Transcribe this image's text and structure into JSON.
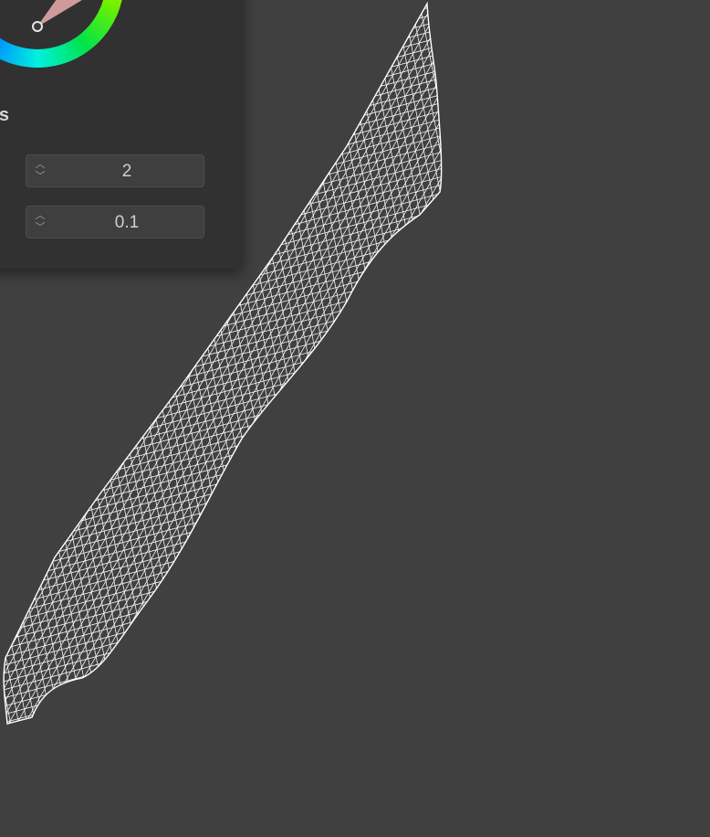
{
  "panel": {
    "section_title": "rs",
    "params": [
      {
        "label": ":",
        "value": "2"
      },
      {
        "label": ":",
        "value": "0.1"
      }
    ]
  },
  "icons": {
    "stepper": "up-down-arrows-icon",
    "picker": "color-picker-handle-icon"
  },
  "colors": {
    "viewport_bg": "#404040",
    "panel_bg": "#313131",
    "field_bg": "#3f3f3f",
    "wireframe": "#ffffff"
  }
}
